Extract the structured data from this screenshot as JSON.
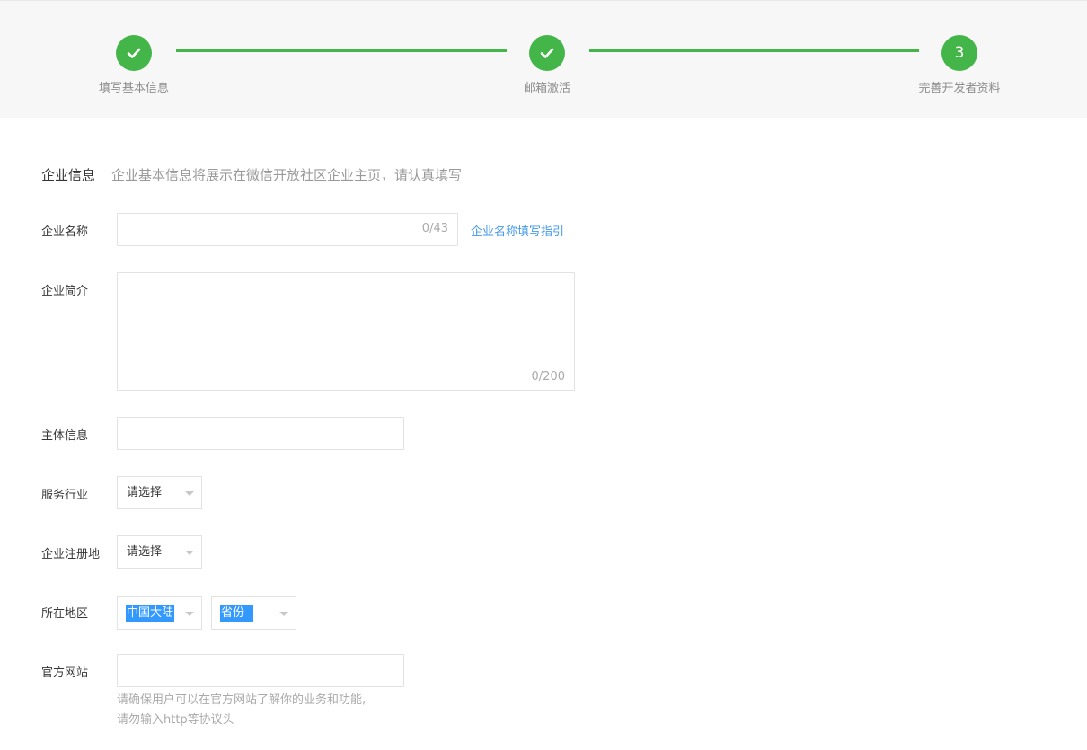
{
  "steps": [
    {
      "label": "填写基本信息",
      "status": "done",
      "icon": "check-icon"
    },
    {
      "label": "邮箱激活",
      "status": "done",
      "icon": "check-icon"
    },
    {
      "label": "完善开发者资料",
      "status": "current",
      "number": "3"
    }
  ],
  "section": {
    "title": "企业信息",
    "description": "企业基本信息将展示在微信开放社区企业主页，请认真填写"
  },
  "form": {
    "company_name": {
      "label": "企业名称",
      "value": "",
      "counter": "0/43",
      "guide_link": "企业名称填写指引"
    },
    "company_intro": {
      "label": "企业简介",
      "value": "",
      "counter": "0/200"
    },
    "entity_info": {
      "label": "主体信息",
      "value": ""
    },
    "industry": {
      "label": "服务行业",
      "selected": "请选择"
    },
    "registration": {
      "label": "企业注册地",
      "selected": "请选择"
    },
    "region": {
      "label": "所在地区",
      "country": "中国大陆",
      "province": "省份"
    },
    "website": {
      "label": "官方网站",
      "value": "",
      "hint_line1": "请确保用户可以在官方网站了解你的业务和功能,",
      "hint_line2": "请勿输入http等协议头"
    }
  },
  "colors": {
    "accent": "#44b549",
    "link": "#459ae9",
    "selection": "#3399ff"
  }
}
